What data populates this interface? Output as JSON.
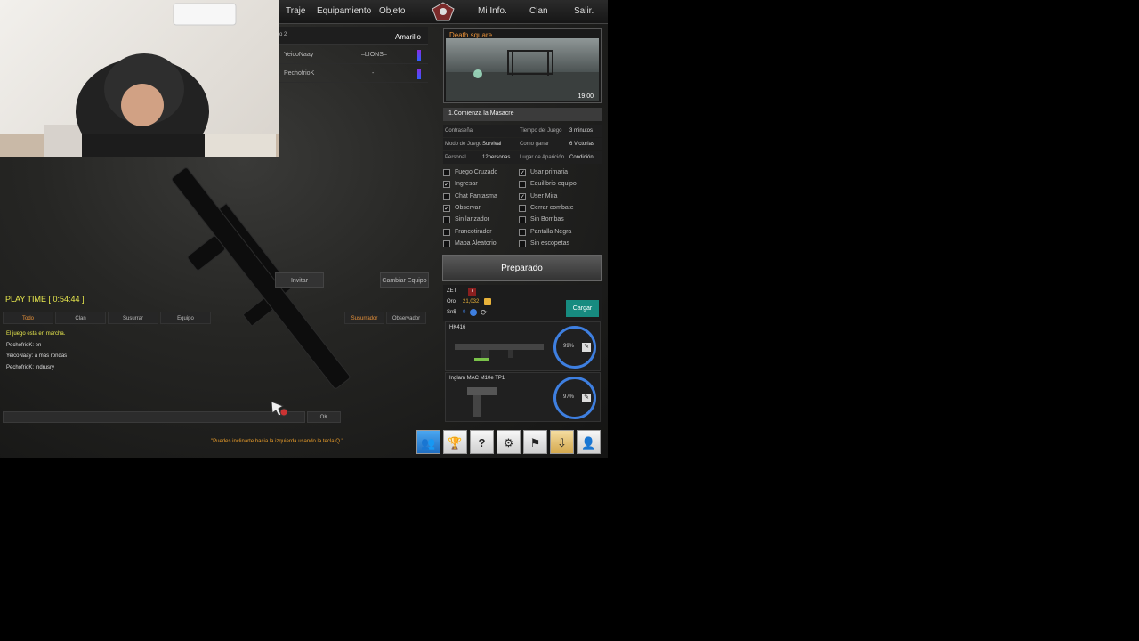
{
  "nav": {
    "items": [
      "Traje",
      "Equipamiento",
      "Objeto",
      "Mi Info.",
      "Clan",
      "Salir."
    ]
  },
  "team_header": {
    "left": "o 2",
    "right": "Amarillo"
  },
  "players": [
    {
      "name": "YeicoNaay",
      "clan": "–LIONS–"
    },
    {
      "name": "PechofrioK",
      "clan": "-"
    }
  ],
  "map": {
    "name": "Death square",
    "time": "19:00"
  },
  "room": {
    "title": "1.Comienza la Masacre",
    "info": [
      {
        "k1": "Contraseña",
        "v1": "",
        "k2": "Tiempo del Juego",
        "v2": "3 minutos"
      },
      {
        "k1": "Modo de Juego",
        "v1": "Survival",
        "k2": "Como ganar",
        "v2": "6 Victorias"
      },
      {
        "k1": "Personal",
        "v1": "12personas",
        "k2": "Lugar de Aparición",
        "v2": "Condición"
      }
    ],
    "options_left": [
      {
        "label": "Fuego Cruzado",
        "checked": false
      },
      {
        "label": "Ingresar",
        "checked": true
      },
      {
        "label": "Chat Fantasma",
        "checked": false
      },
      {
        "label": "Observar",
        "checked": true
      },
      {
        "label": "Sin lanzador",
        "checked": false
      },
      {
        "label": "Francotirador",
        "checked": false
      },
      {
        "label": "Mapa Aleatorio",
        "checked": false
      }
    ],
    "options_right": [
      {
        "label": "Usar primaria",
        "checked": true
      },
      {
        "label": "Equilibrio equipo",
        "checked": false
      },
      {
        "label": "User Mira",
        "checked": true
      },
      {
        "label": "Cerrar combate",
        "checked": false
      },
      {
        "label": "Sin Bombas",
        "checked": false
      },
      {
        "label": "Pantalla Negra",
        "checked": false
      },
      {
        "label": "Sin escopetas",
        "checked": false
      }
    ],
    "ready_label": "Preparado"
  },
  "wallet": {
    "zet_label": "ZET",
    "zet_value": "7",
    "oro_label": "Oro",
    "oro_value": "21,032",
    "sn_label": "Sn$",
    "sn_value": "0",
    "cargar_label": "Cargar"
  },
  "weapons": [
    {
      "name": "HK416",
      "durability": "99%",
      "durability_value": 0.99
    },
    {
      "name": "Inglam MAC M10e TP1",
      "durability": "97%",
      "durability_value": 0.97
    }
  ],
  "chat": {
    "playtime": "PLAY TIME [ 0:54:44 ]",
    "tabs": [
      "Todo",
      "Clan",
      "Susurrar",
      "Equipo"
    ],
    "whisper_label": "Susurrador",
    "observer_label": "Observador",
    "messages": [
      {
        "text": "El juego está en marcha.",
        "color": "#e9e94e"
      },
      {
        "text": "PechofrioK: en",
        "color": "#dddddd"
      },
      {
        "text": "YeicoNaay: a mas rondas",
        "color": "#dddddd"
      },
      {
        "text": "PechofrioK: indrusry",
        "color": "#dddddd"
      }
    ],
    "ok_label": "OK",
    "tip": "\"Puedes inclinarte hacia la izquierda usando la tecla Q.\""
  },
  "buttons": {
    "invite_label": "Invitar",
    "change_team_label": "Cambiar Equipo"
  },
  "bottom_icons": [
    "friends-icon",
    "trophy-icon",
    "help-icon",
    "settings-icon",
    "flag-icon",
    "download-icon",
    "profile-icon"
  ],
  "colors": {
    "accent_teal": "#178b80",
    "playtime_yellow": "#e9e94e",
    "tip_orange": "#e89c2a",
    "ring_blue": "#3e7fe0"
  }
}
